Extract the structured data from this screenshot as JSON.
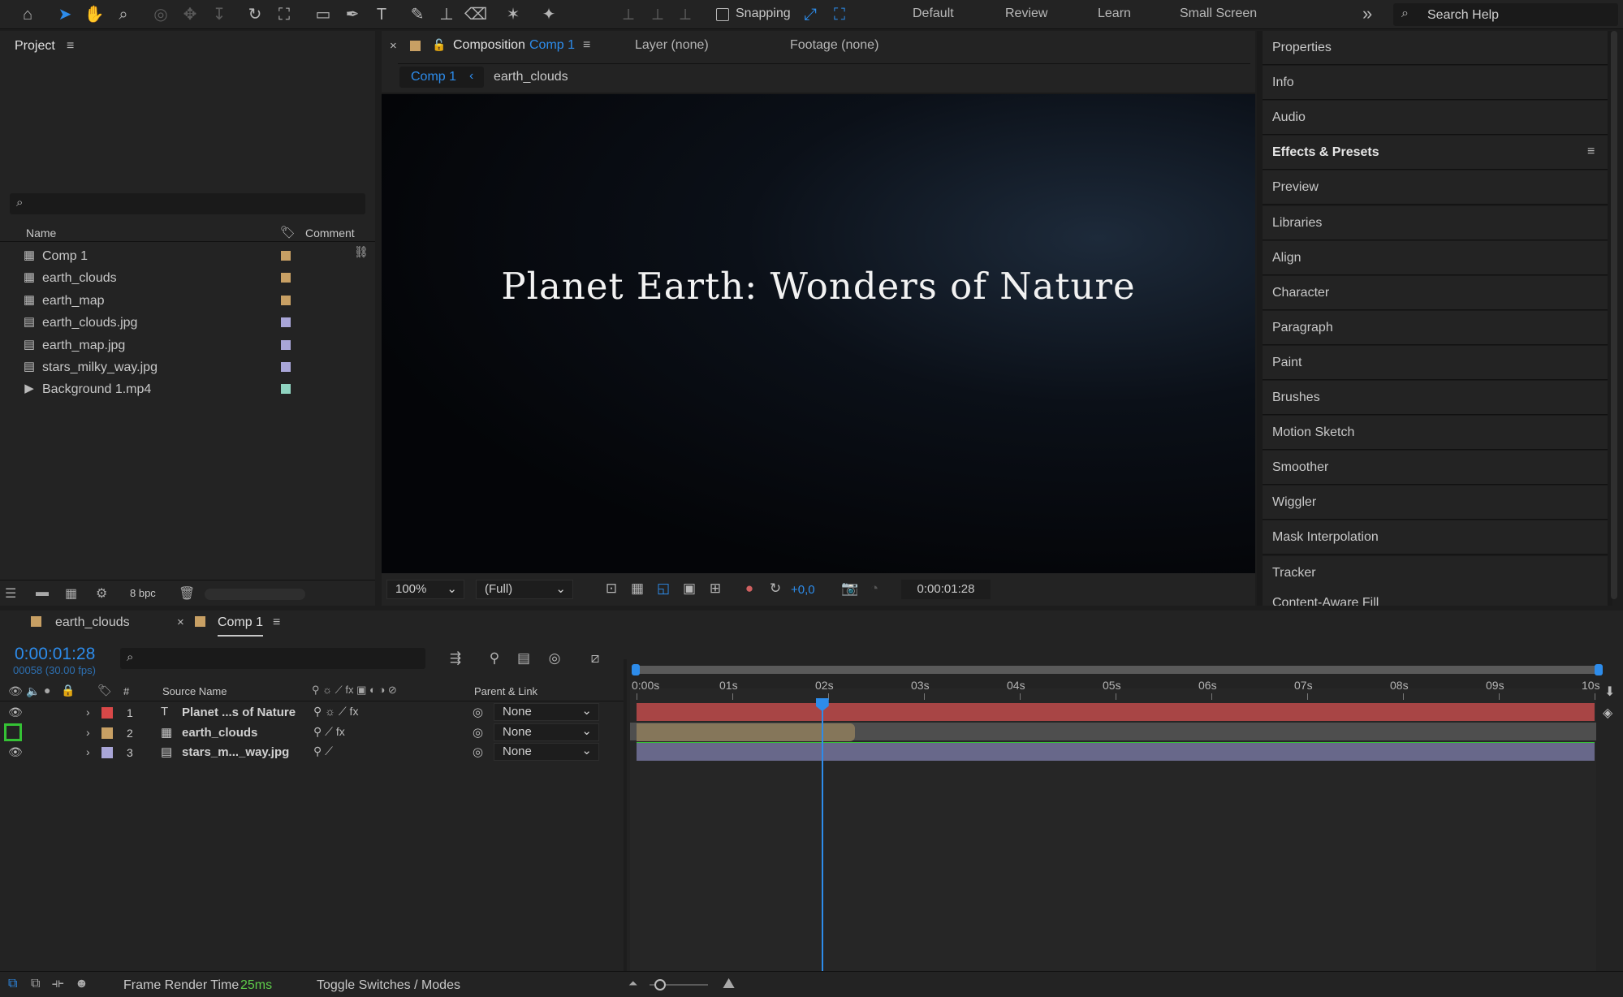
{
  "toolbar": {
    "snapping_label": "Snapping",
    "workspaces": [
      "Default",
      "Review",
      "Learn",
      "Small Screen"
    ],
    "search_placeholder": "Search Help",
    "more": "»"
  },
  "project": {
    "title": "Project",
    "col_name": "Name",
    "col_comment": "Comment",
    "items": [
      {
        "name": "Comp 1",
        "type": "comp",
        "color": "#c8a064"
      },
      {
        "name": "earth_clouds",
        "type": "comp",
        "color": "#c8a064"
      },
      {
        "name": "earth_map",
        "type": "comp",
        "color": "#c8a064"
      },
      {
        "name": "earth_clouds.jpg",
        "type": "file",
        "color": "#a9a6d8"
      },
      {
        "name": "earth_map.jpg",
        "type": "file",
        "color": "#a9a6d8"
      },
      {
        "name": "stars_milky_way.jpg",
        "type": "file",
        "color": "#a9a6d8"
      },
      {
        "name": "Background 1.mp4",
        "type": "video",
        "color": "#8fd3c0"
      }
    ],
    "bpc": "8 bpc"
  },
  "composition": {
    "tab_label": "Composition",
    "tab_name": "Comp 1",
    "layer_tab": "Layer (none)",
    "footage_tab": "Footage (none)",
    "breadcrumb": [
      "Comp 1",
      "earth_clouds"
    ],
    "viewer_text": "Planet Earth: Wonders of Nature",
    "zoom": "100%",
    "resolution": "(Full)",
    "exposure": "+0,0",
    "timecode": "0:00:01:28"
  },
  "right_panel": {
    "items": [
      "Properties",
      "Info",
      "Audio",
      "Effects & Presets",
      "Preview",
      "Libraries",
      "Align",
      "Character",
      "Paragraph",
      "Paint",
      "Brushes",
      "Motion Sketch",
      "Smoother",
      "Wiggler",
      "Mask Interpolation",
      "Tracker"
    ],
    "partial": "Content-Aware Fill"
  },
  "timeline": {
    "tabs": [
      "earth_clouds",
      "Comp 1"
    ],
    "timecode": "0:00:01:28",
    "frame_info": "00058 (30.00 fps)",
    "col_num": "#",
    "col_source": "Source Name",
    "col_parent": "Parent & Link",
    "layers": [
      {
        "num": "1",
        "name": "Planet ...s of Nature",
        "type": "T",
        "color": "#d94848",
        "parent": "None",
        "bar_color": "#a84545"
      },
      {
        "num": "2",
        "name": "earth_clouds",
        "type": "comp",
        "color": "#c8a064",
        "parent": "None",
        "bar_color": "#85765a"
      },
      {
        "num": "3",
        "name": "stars_m..._way.jpg",
        "type": "file",
        "color": "#a9a6d8",
        "parent": "None",
        "bar_color": "#68688a"
      }
    ],
    "ruler": [
      "0:00s",
      "01s",
      "02s",
      "03s",
      "04s",
      "05s",
      "06s",
      "07s",
      "08s",
      "09s",
      "10s"
    ],
    "playhead_seconds": 1.93,
    "duration_seconds": 10,
    "layer2_end_seconds": 2.28
  },
  "status": {
    "render_label": "Frame Render Time",
    "render_value": "25ms",
    "toggle": "Toggle Switches / Modes"
  },
  "colors": {
    "accent": "#2d8ceb",
    "render_value": "#5ecb4a",
    "green_bar": "#35c235"
  }
}
